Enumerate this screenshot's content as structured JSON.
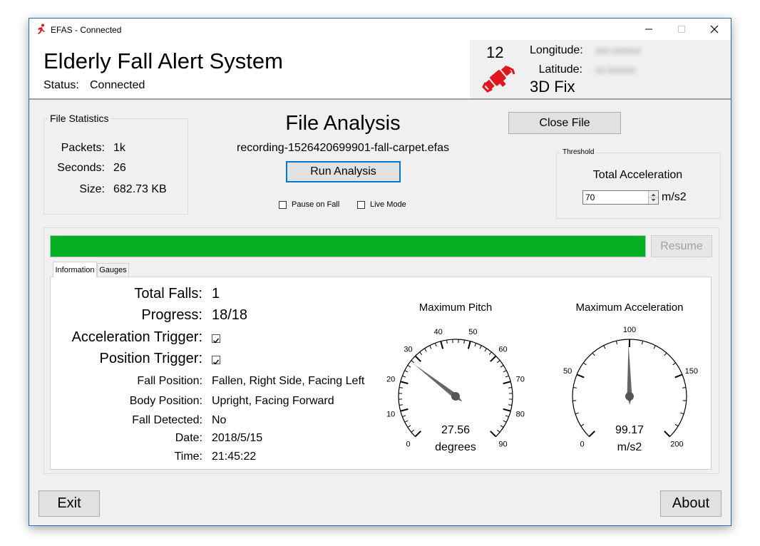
{
  "window": {
    "title": "EFAS - Connected",
    "controls": {
      "minimize": "─",
      "maximize": "☐",
      "close": "✕"
    }
  },
  "header": {
    "app_title": "Elderly Fall Alert System",
    "status_label": "Status:",
    "status_value": "Connected",
    "gps": {
      "satellites": "12",
      "fix": "3D Fix",
      "longitude_label": "Longitude:",
      "latitude_label": "Latitude:",
      "icon": "satellite-icon",
      "icon_color": "#e0161e"
    }
  },
  "file_statistics": {
    "title": "File Statistics",
    "rows": [
      {
        "label": "Packets:",
        "value": "1k"
      },
      {
        "label": "Seconds:",
        "value": "26"
      },
      {
        "label": "Size:",
        "value": "682.73 KB"
      }
    ]
  },
  "analysis": {
    "title": "File Analysis",
    "filename": "recording-1526420699901-fall-carpet.efas",
    "run_button": "Run Analysis",
    "pause_on_fall_label": "Pause on Fall",
    "pause_on_fall_checked": false,
    "live_mode_label": "Live Mode",
    "live_mode_checked": false,
    "close_button": "Close File"
  },
  "threshold": {
    "title": "Threshold",
    "label": "Total Acceleration",
    "value": "70",
    "unit": "m/s2"
  },
  "progress": {
    "fraction": 1.0,
    "color": "#06b025",
    "resume_button": "Resume"
  },
  "tabs": [
    {
      "label": "Information",
      "active": true
    },
    {
      "label": "Gauges",
      "active": false
    }
  ],
  "info": {
    "total_falls_label": "Total Falls:",
    "total_falls": "1",
    "progress_label": "Progress:",
    "progress": "18/18",
    "acceleration_trigger_label": "Acceleration Trigger:",
    "acceleration_trigger_checked": true,
    "position_trigger_label": "Position Trigger:",
    "position_trigger_checked": true,
    "fall_position_label": "Fall Position:",
    "fall_position": "Fallen, Right Side, Facing Left",
    "body_position_label": "Body Position:",
    "body_position": "Upright, Facing Forward",
    "fall_detected_label": "Fall Detected:",
    "fall_detected": "No",
    "date_label": "Date:",
    "date": "2018/5/15",
    "time_label": "Time:",
    "time": "21:45:22"
  },
  "gauges": {
    "pitch": {
      "title": "Maximum Pitch",
      "min": 0,
      "max": 90,
      "ticks": [
        "0",
        "10",
        "20",
        "30",
        "40",
        "50",
        "60",
        "70",
        "80",
        "90"
      ],
      "value": 27.56,
      "value_text": "27.56",
      "unit": "degrees"
    },
    "acceleration": {
      "title": "Maximum Acceleration",
      "min": 0,
      "max": 200,
      "ticks": [
        "0",
        "50",
        "100",
        "150",
        "200"
      ],
      "value": 99.17,
      "value_text": "99.17",
      "unit": "m/s2"
    }
  },
  "buttons": {
    "exit": "Exit",
    "about": "About"
  }
}
